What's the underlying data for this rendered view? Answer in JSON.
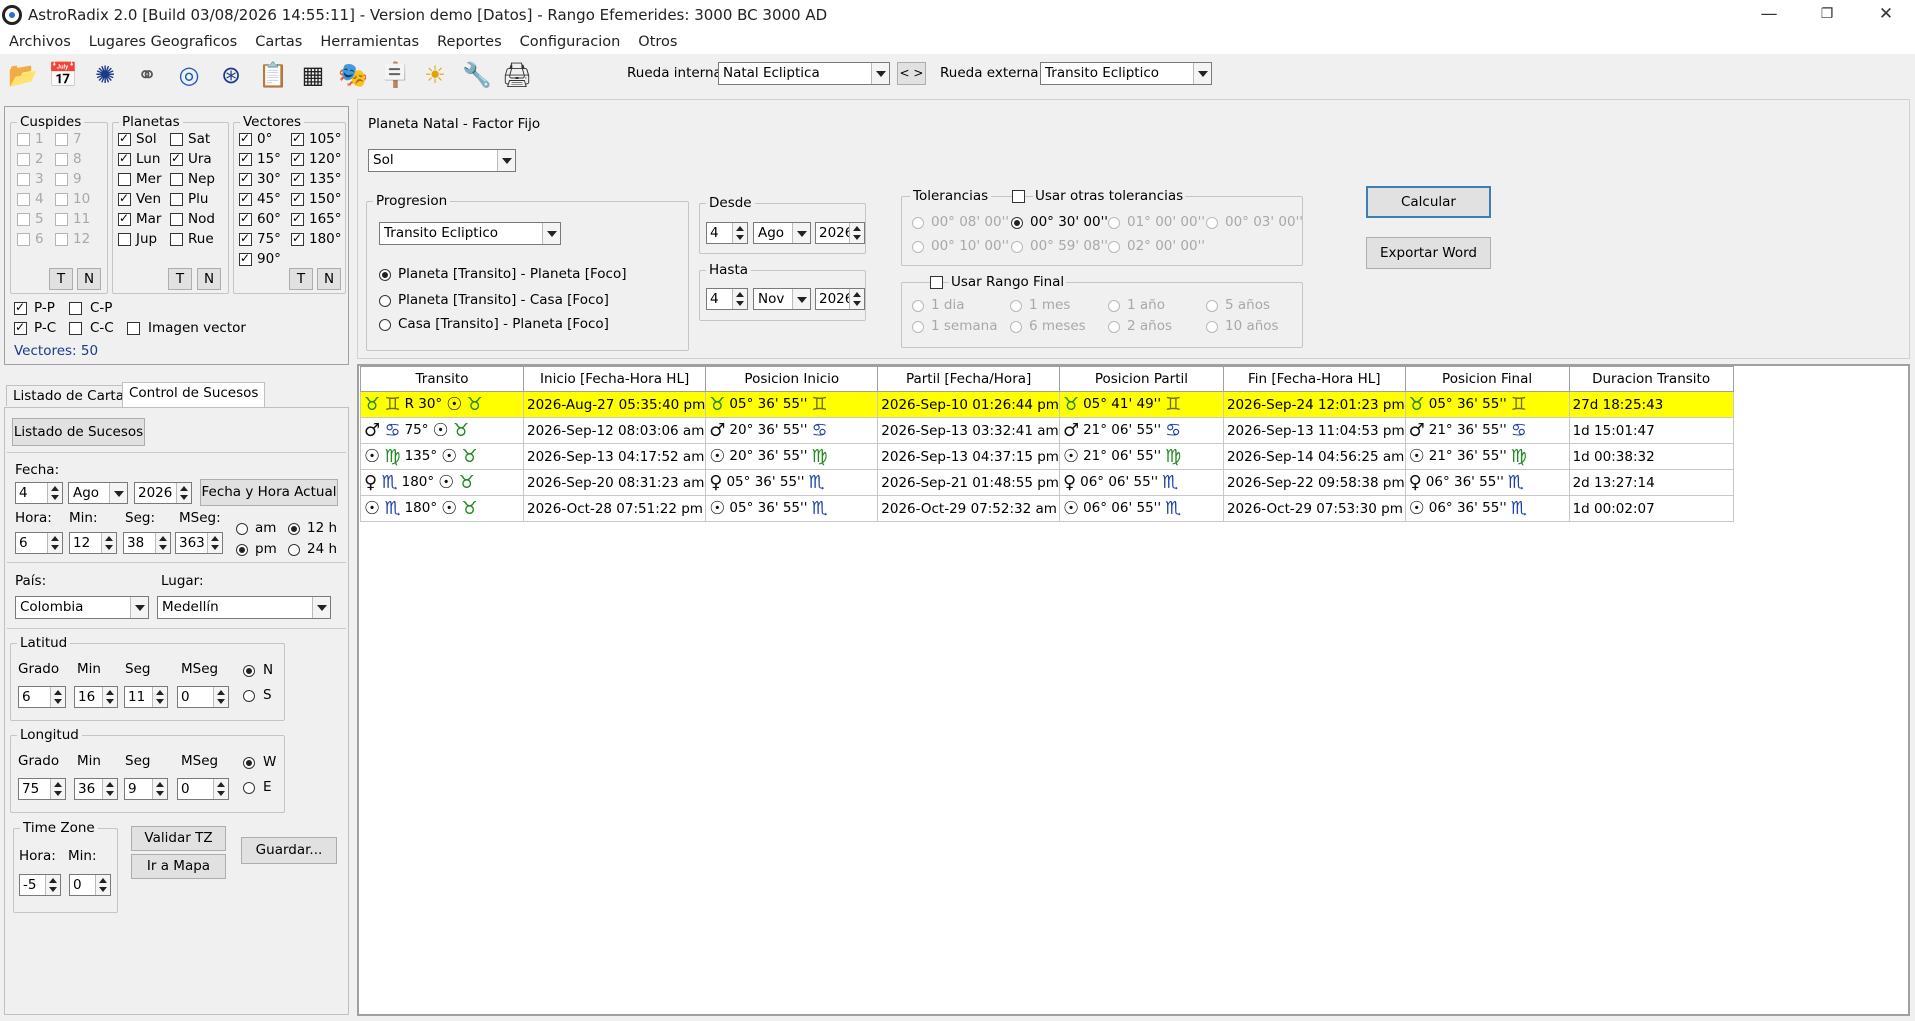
{
  "window": {
    "title": "AstroRadix 2.0 [Build 03/08/2026 14:55:11] - Version demo [Datos] - Rango Efemerides: 3000 BC  3000 AD"
  },
  "menu": [
    "Archivos",
    "Lugares Geograficos",
    "Cartas",
    "Herramientas",
    "Reportes",
    "Configuracion",
    "Otros"
  ],
  "toolbar": {
    "rueda_interna_label": "Rueda interna",
    "rueda_interna_value": "Natal Ecliptica",
    "swap_label": "< >",
    "rueda_externa_label": "Rueda externa",
    "rueda_externa_value": "Transito Ecliptico"
  },
  "cuspides": {
    "title": "Cuspides",
    "items": [
      "1",
      "2",
      "3",
      "4",
      "5",
      "6",
      "7",
      "8",
      "9",
      "10",
      "11",
      "12"
    ],
    "t": "T",
    "n": "N"
  },
  "planetas": {
    "title": "Planetas",
    "col1": [
      "Sol",
      "Lun",
      "Mer",
      "Ven",
      "Mar",
      "Jup"
    ],
    "col2": [
      "Sat",
      "Ura",
      "Nep",
      "Plu",
      "Nod",
      "Rue"
    ],
    "t": "T",
    "n": "N"
  },
  "vectores": {
    "title": "Vectores",
    "col1": [
      "0°",
      "15°",
      "30°",
      "45°",
      "60°",
      "75°",
      "90°"
    ],
    "col2": [
      "105°",
      "120°",
      "135°",
      "150°",
      "165°",
      "180°"
    ],
    "t": "T",
    "n": "N"
  },
  "options": {
    "pp": "P-P",
    "cp": "C-P",
    "pc": "P-C",
    "cc": "C-C",
    "imagen_vector": "Imagen vector",
    "vectores_count": "Vectores: 50"
  },
  "tabs": [
    "Listado de Cartas",
    "Control de Sucesos"
  ],
  "sucesos": {
    "listado_button": "Listado de Sucesos",
    "fecha_label": "Fecha:",
    "day": "4",
    "month": "Ago",
    "year": "2026",
    "fecha_actual_button": "Fecha y Hora Actual",
    "hora_label": "Hora:",
    "min_label": "Min:",
    "seg_label": "Seg:",
    "mseg_label": "MSeg:",
    "hora": "6",
    "min": "12",
    "seg": "38",
    "mseg": "363",
    "am": "am",
    "pm": "pm",
    "h12": "12 h",
    "h24": "24 h",
    "pais_label": "País:",
    "pais": "Colombia",
    "lugar_label": "Lugar:",
    "lugar": "Medellín"
  },
  "latitud": {
    "title": "Latitud",
    "grado_label": "Grado",
    "min_label": "Min",
    "seg_label": "Seg",
    "mseg_label": "MSeg",
    "grado": "6",
    "min": "16",
    "seg": "11",
    "mseg": "0",
    "n": "N",
    "s": "S"
  },
  "longitud": {
    "title": "Longitud",
    "grado_label": "Grado",
    "min_label": "Min",
    "seg_label": "Seg",
    "mseg_label": "MSeg",
    "grado": "75",
    "min": "36",
    "seg": "9",
    "mseg": "0",
    "w": "W",
    "e": "E"
  },
  "timezone": {
    "title": "Time Zone",
    "hora_label": "Hora:",
    "min_label": "Min:",
    "hora": "-5",
    "min": "0",
    "validar": "Validar TZ",
    "mapa": "Ir a Mapa",
    "guardar": "Guardar..."
  },
  "config": {
    "planeta_label": "Planeta Natal - Factor Fijo",
    "planeta_value": "Sol",
    "progresion_title": "Progresion",
    "progresion_value": "Transito Ecliptico",
    "prog_options": [
      "Planeta [Transito] - Planeta [Foco]",
      "Planeta [Transito] - Casa [Foco]",
      "Casa [Transito] - Planeta [Foco]"
    ],
    "desde_title": "Desde",
    "desde_day": "4",
    "desde_month": "Ago",
    "desde_year": "2026",
    "hasta_title": "Hasta",
    "hasta_day": "4",
    "hasta_month": "Nov",
    "hasta_year": "2026",
    "tolerancias_title": "Tolerancias",
    "usar_otras": "Usar otras tolerancias",
    "tol_row1": [
      "00° 08' 00''",
      "00° 30' 00''",
      "01° 00' 00''",
      "00° 03' 00''"
    ],
    "tol_row2": [
      "00° 10' 00''",
      "00° 59' 08''",
      "02° 00' 00''"
    ],
    "usar_rango": "Usar Rango Final",
    "rango_row1": [
      "1 dia",
      "1 mes",
      "1 año",
      "5 años"
    ],
    "rango_row2": [
      "1 semana",
      "6 meses",
      "2 años",
      "10 años"
    ],
    "calcular": "Calcular",
    "exportar": "Exportar Word"
  },
  "table": {
    "headers": [
      "Transito",
      "Inicio [Fecha-Hora HL]",
      "Posicion Inicio",
      "Partil [Fecha/Hora]",
      "Posicion Partil",
      "Fin  [Fecha-Hora HL]",
      "Posicion Final",
      "Duracion Transito"
    ],
    "rows": [
      {
        "t_a": "♉",
        "t_b": "♊",
        "t_txt": "R 30°",
        "t_c": "☉",
        "t_d": "♉",
        "inicio": "2026-Aug-27 05:35:40 pm",
        "pi_p": "♉",
        "pi_txt": "05° 36' 55''",
        "pi_s": "♊",
        "partil": "2026-Sep-10 01:26:44 pm",
        "pp_p": "♉",
        "pp_txt": "05° 41' 49''",
        "pp_s": "♊",
        "fin": "2026-Sep-24 12:01:23 pm",
        "pf_p": "♉",
        "pf_txt": "05° 36' 55''",
        "pf_s": "♊",
        "duracion": "27d 18:25:43"
      },
      {
        "t_a": "♂",
        "t_b": "♋",
        "t_txt": "75°",
        "t_c": "☉",
        "t_d": "♉",
        "inicio": "2026-Sep-12 08:03:06 am",
        "pi_p": "♂",
        "pi_txt": "20° 36' 55''",
        "pi_s": "♋",
        "partil": "2026-Sep-13 03:32:41 am",
        "pp_p": "♂",
        "pp_txt": "21° 06' 55''",
        "pp_s": "♋",
        "fin": "2026-Sep-13 11:04:53 pm",
        "pf_p": "♂",
        "pf_txt": "21° 36' 55''",
        "pf_s": "♋",
        "duracion": "1d 15:01:47"
      },
      {
        "t_a": "☉",
        "t_b": "♍",
        "t_txt": "135°",
        "t_c": "☉",
        "t_d": "♉",
        "inicio": "2026-Sep-13 04:17:52 am",
        "pi_p": "☉",
        "pi_txt": "20° 36' 55''",
        "pi_s": "♍",
        "partil": "2026-Sep-13 04:37:15 pm",
        "pp_p": "☉",
        "pp_txt": "21° 06' 55''",
        "pp_s": "♍",
        "fin": "2026-Sep-14 04:56:25 am",
        "pf_p": "☉",
        "pf_txt": "21° 36' 55''",
        "pf_s": "♍",
        "duracion": "1d 00:38:32"
      },
      {
        "t_a": "♀",
        "t_b": "♏",
        "t_txt": "180°",
        "t_c": "☉",
        "t_d": "♉",
        "inicio": "2026-Sep-20 08:31:23 am",
        "pi_p": "♀",
        "pi_txt": "05° 36' 55''",
        "pi_s": "♏",
        "partil": "2026-Sep-21 01:48:55 pm",
        "pp_p": "♀",
        "pp_txt": "06° 06' 55''",
        "pp_s": "♏",
        "fin": "2026-Sep-22 09:58:38 pm",
        "pf_p": "♀",
        "pf_txt": "06° 36' 55''",
        "pf_s": "♏",
        "duracion": "2d 13:27:14"
      },
      {
        "t_a": "☉",
        "t_b": "♏",
        "t_txt": "180°",
        "t_c": "☉",
        "t_d": "♉",
        "inicio": "2026-Oct-28 07:51:22 pm",
        "pi_p": "☉",
        "pi_txt": "05° 36' 55''",
        "pi_s": "♏",
        "partil": "2026-Oct-29 07:52:32 am",
        "pp_p": "☉",
        "pp_txt": "06° 06' 55''",
        "pp_s": "♏",
        "fin": "2026-Oct-29 07:53:30 pm",
        "pf_p": "☉",
        "pf_txt": "06° 36' 55''",
        "pf_s": "♏",
        "duracion": "1d 00:02:07"
      }
    ]
  },
  "colors": {
    "highlight": "#ffff00",
    "sign_blue": "#1d3fa8",
    "sign_green": "#1f8a1f",
    "link_blue": "#1a3a8a"
  }
}
